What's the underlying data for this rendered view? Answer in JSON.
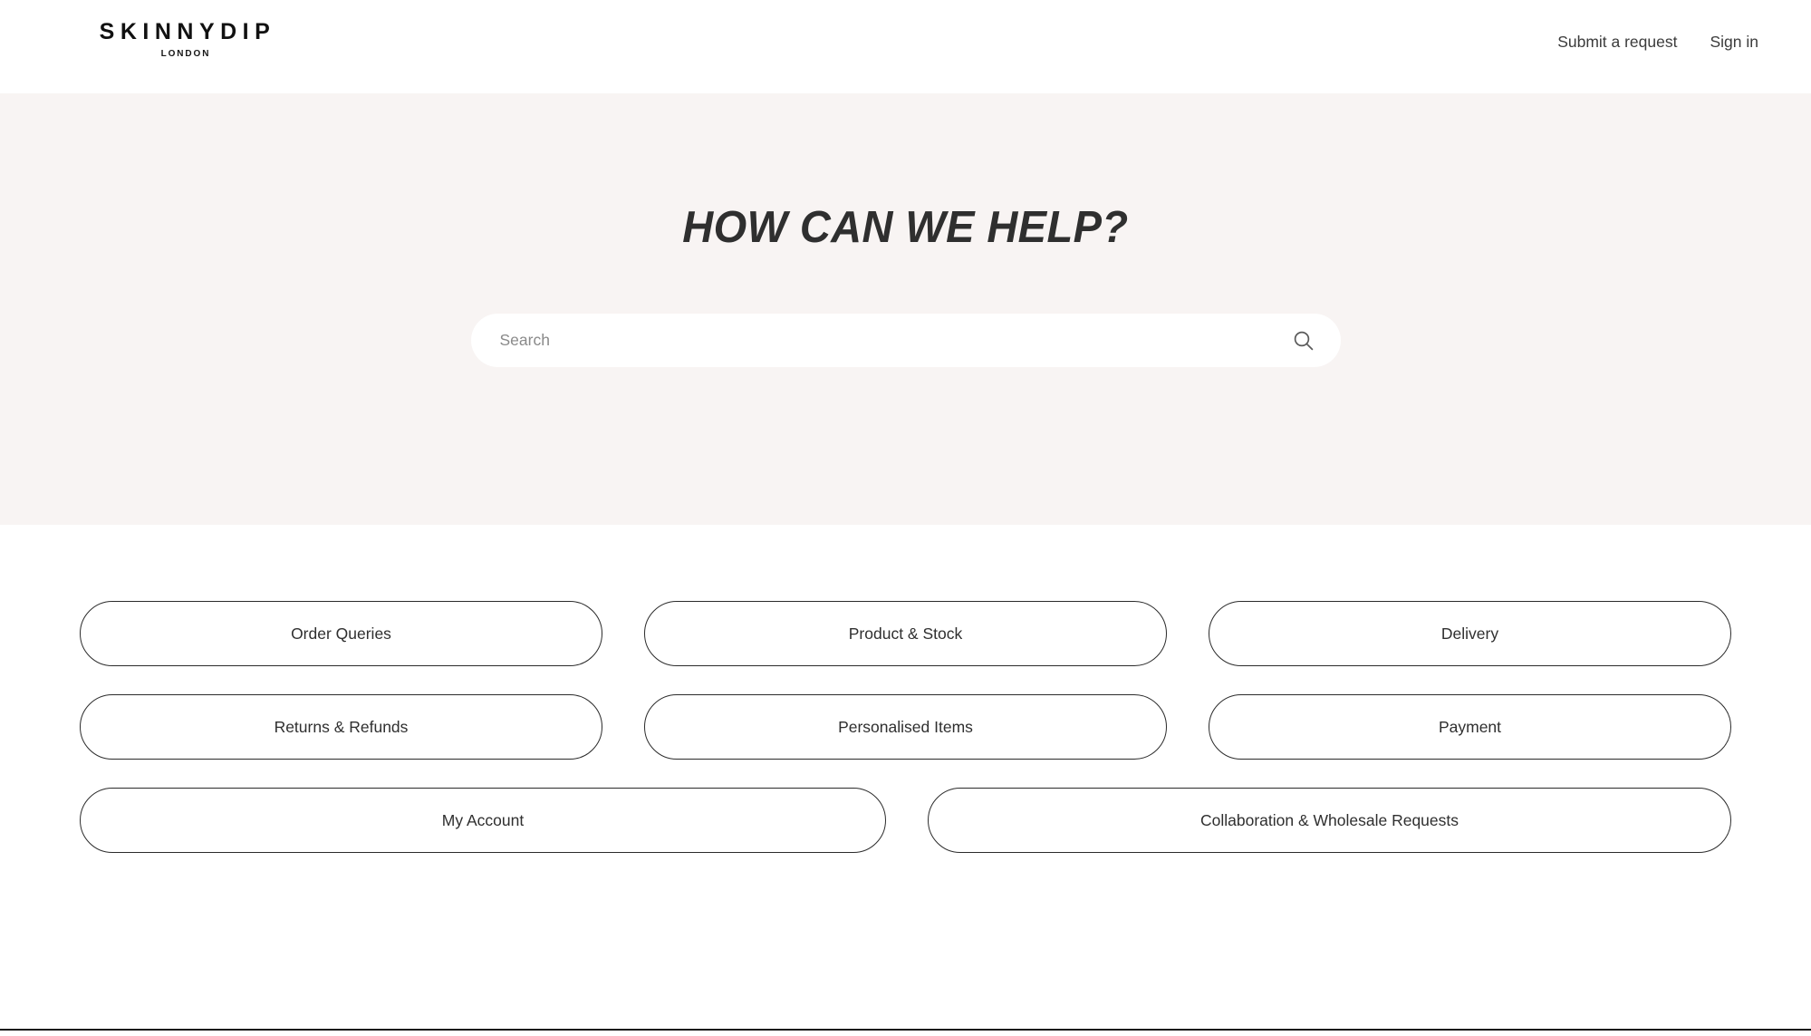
{
  "header": {
    "logo": {
      "word": "SKINNYDIP",
      "sub": "LONDON"
    },
    "nav": [
      {
        "label": "Submit a request",
        "name": "submit-a-request"
      },
      {
        "label": "Sign in",
        "name": "sign-in"
      }
    ]
  },
  "hero": {
    "title": "HOW CAN WE HELP?",
    "background_color": "#f8f4f3",
    "search": {
      "placeholder": "Search",
      "value": "",
      "icon": "search-icon"
    }
  },
  "categories": {
    "rows": [
      [
        {
          "label": "Order Queries"
        },
        {
          "label": "Product & Stock"
        },
        {
          "label": "Delivery"
        }
      ],
      [
        {
          "label": "Returns & Refunds"
        },
        {
          "label": "Personalised Items"
        },
        {
          "label": "Payment"
        }
      ],
      [
        {
          "label": "My Account"
        },
        {
          "label": "Collaboration & Wholesale Requests"
        }
      ]
    ]
  },
  "colors": {
    "page_background": "#ffffff",
    "hero_background": "#f8f4f3",
    "text_primary": "#2f2f2f",
    "border": "#2b2b2b"
  }
}
